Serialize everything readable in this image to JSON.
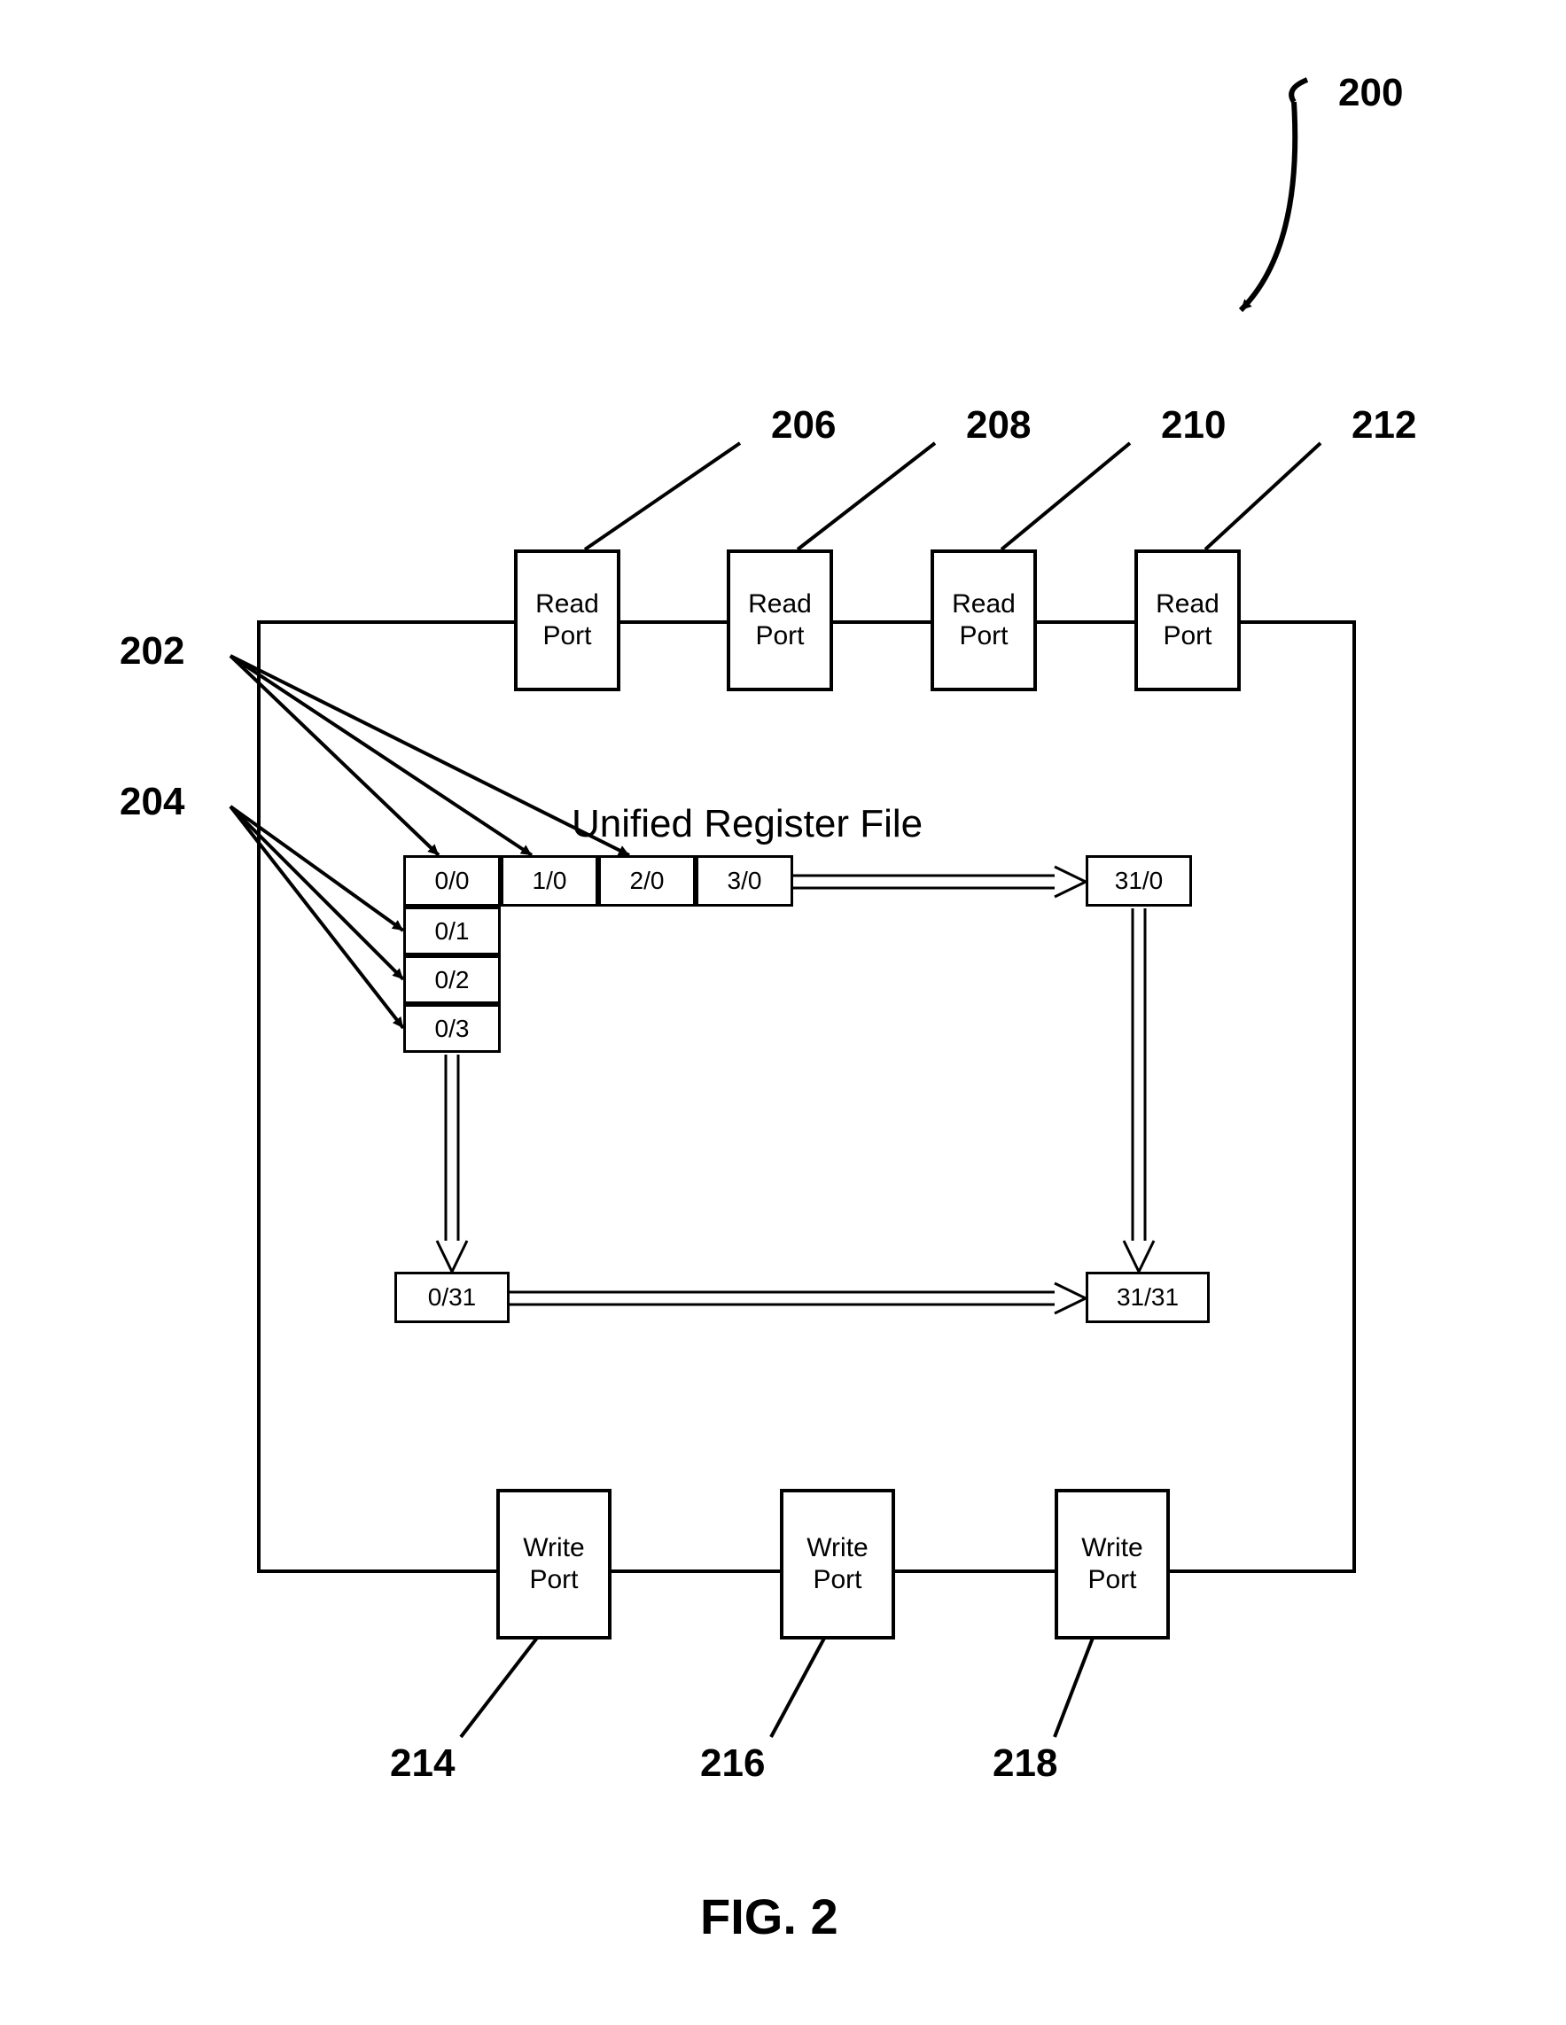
{
  "figure_ref": "200",
  "labels": {
    "ref202": "202",
    "ref204": "204",
    "ref206": "206",
    "ref208": "208",
    "ref210": "210",
    "ref212": "212",
    "ref214": "214",
    "ref216": "216",
    "ref218": "218"
  },
  "ports": {
    "read1": "Read",
    "read2": "Port",
    "write1": "Write",
    "write2": "Port"
  },
  "title": "Unified Register File",
  "cells": {
    "c00": "0/0",
    "c10": "1/0",
    "c20": "2/0",
    "c30": "3/0",
    "c310": "31/0",
    "c01": "0/1",
    "c02": "0/2",
    "c03": "0/3",
    "c031": "0/31",
    "c3131": "31/31"
  },
  "caption": "FIG. 2"
}
